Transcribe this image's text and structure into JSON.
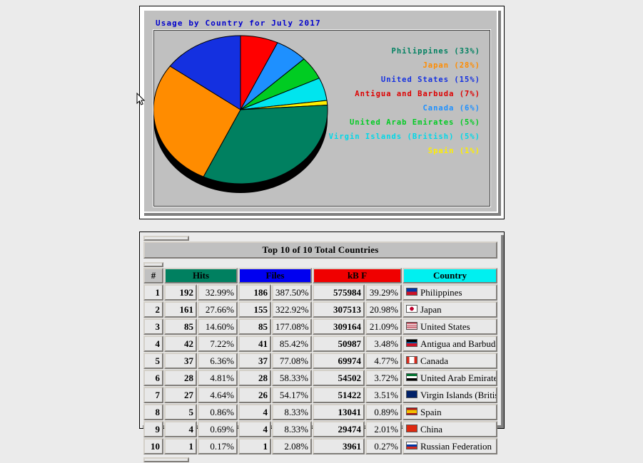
{
  "page": {
    "background": "#ebebeb"
  },
  "chart": {
    "title": "Usage by Country for July 2017",
    "title_color": "#0000cc",
    "panel_background": "#c0c0c0"
  },
  "chart_data": {
    "type": "pie",
    "title": "Usage by Country for July 2017",
    "legend_position": "right",
    "grid": false,
    "start_angle_deg": 0,
    "direction": "clockwise",
    "categories": [
      "Antigua and Barbuda",
      "Canada",
      "United Arab Emirates",
      "Virgin Islands (British)",
      "Spain",
      "Philippines",
      "Japan",
      "United States"
    ],
    "values": [
      7,
      6,
      5,
      5,
      1,
      33,
      28,
      15
    ],
    "colors": [
      "#ff0000",
      "#1e90ff",
      "#00cc22",
      "#00e5ee",
      "#ffee00",
      "#008060",
      "#ff8c00",
      "#1430e0"
    ],
    "legend": [
      {
        "label": "Philippines (33%)",
        "color": "#008060"
      },
      {
        "label": "Japan (28%)",
        "color": "#ff8c00"
      },
      {
        "label": "United States (15%)",
        "color": "#1430e0"
      },
      {
        "label": "Antigua and Barbuda (7%)",
        "color": "#dd0000"
      },
      {
        "label": "Canada (6%)",
        "color": "#1e90ff"
      },
      {
        "label": "United Arab Emirates (5%)",
        "color": "#00cc22"
      },
      {
        "label": "Virgin Islands (British) (5%)",
        "color": "#00d8e8"
      },
      {
        "label": "Spain (1%)",
        "color": "#ffee00"
      }
    ]
  },
  "table": {
    "title": "Top 10 of 10 Total Countries",
    "headers": {
      "rank": "#",
      "hits": "Hits",
      "files": "Files",
      "kbf": "kB F",
      "country": "Country"
    },
    "header_colors": {
      "hits": "#008060",
      "files": "#0000f0",
      "kbf": "#f00000",
      "country": "#00f0f0"
    },
    "rows": [
      {
        "rank": "1",
        "hits": "192",
        "hits_pct": "32.99%",
        "files": "186",
        "files_pct": "387.50%",
        "kbf": "575984",
        "kbf_pct": "39.29%",
        "country": "Philippines",
        "flag": "flag-philippines"
      },
      {
        "rank": "2",
        "hits": "161",
        "hits_pct": "27.66%",
        "files": "155",
        "files_pct": "322.92%",
        "kbf": "307513",
        "kbf_pct": "20.98%",
        "country": "Japan",
        "flag": "flag-japan"
      },
      {
        "rank": "3",
        "hits": "85",
        "hits_pct": "14.60%",
        "files": "85",
        "files_pct": "177.08%",
        "kbf": "309164",
        "kbf_pct": "21.09%",
        "country": "United States",
        "flag": "flag-united-states"
      },
      {
        "rank": "4",
        "hits": "42",
        "hits_pct": "7.22%",
        "files": "41",
        "files_pct": "85.42%",
        "kbf": "50987",
        "kbf_pct": "3.48%",
        "country": "Antigua and Barbuda",
        "flag": "flag-antigua-and-barbuda"
      },
      {
        "rank": "5",
        "hits": "37",
        "hits_pct": "6.36%",
        "files": "37",
        "files_pct": "77.08%",
        "kbf": "69974",
        "kbf_pct": "4.77%",
        "country": "Canada",
        "flag": "flag-canada"
      },
      {
        "rank": "6",
        "hits": "28",
        "hits_pct": "4.81%",
        "files": "28",
        "files_pct": "58.33%",
        "kbf": "54502",
        "kbf_pct": "3.72%",
        "country": "United Arab Emirates",
        "flag": "flag-united-arab-emirates"
      },
      {
        "rank": "7",
        "hits": "27",
        "hits_pct": "4.64%",
        "files": "26",
        "files_pct": "54.17%",
        "kbf": "51422",
        "kbf_pct": "3.51%",
        "country": "Virgin Islands (British)",
        "flag": "flag-virgin-islands-british"
      },
      {
        "rank": "8",
        "hits": "5",
        "hits_pct": "0.86%",
        "files": "4",
        "files_pct": "8.33%",
        "kbf": "13041",
        "kbf_pct": "0.89%",
        "country": "Spain",
        "flag": "flag-spain"
      },
      {
        "rank": "9",
        "hits": "4",
        "hits_pct": "0.69%",
        "files": "4",
        "files_pct": "8.33%",
        "kbf": "29474",
        "kbf_pct": "2.01%",
        "country": "China",
        "flag": "flag-china"
      },
      {
        "rank": "10",
        "hits": "1",
        "hits_pct": "0.17%",
        "files": "1",
        "files_pct": "2.08%",
        "kbf": "3961",
        "kbf_pct": "0.27%",
        "country": "Russian Federation",
        "flag": "flag-russian-federation"
      }
    ]
  },
  "cursor": {
    "icon": "mouse-pointer-icon"
  }
}
